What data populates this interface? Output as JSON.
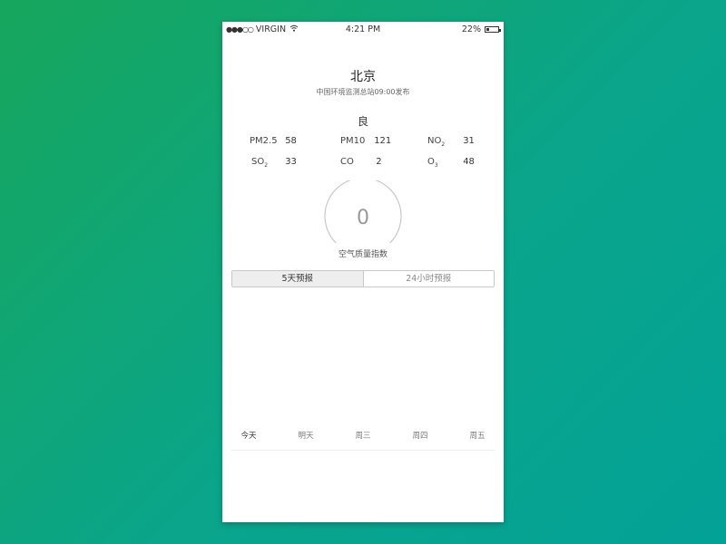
{
  "status_bar": {
    "carrier": "VIRGIN",
    "signal_dots": "●●●○○",
    "time": "4:21 PM",
    "battery_text": "22%",
    "battery_level": 0.22
  },
  "header": {
    "city": "北京",
    "source": "中国环境监测总站09:00发布",
    "quality": "良"
  },
  "pollutants": {
    "pm25": {
      "label": "PM2.5",
      "value": "58"
    },
    "pm10": {
      "label": "PM10",
      "value": "121"
    },
    "no2": {
      "label": "NO",
      "sub": "2",
      "value": "31"
    },
    "so2": {
      "label": "SO",
      "sub": "2",
      "value": "33"
    },
    "co": {
      "label": "CO",
      "value": "2"
    },
    "o3": {
      "label": "O",
      "sub": "3",
      "value": "48"
    }
  },
  "aqi": {
    "value": "0",
    "label": "空气质量指数"
  },
  "tabs": {
    "five_day": "5天预报",
    "hourly": "24小时预报"
  },
  "forecast_days": [
    "今天",
    "明天",
    "周三",
    "周四",
    "周五"
  ],
  "colors": {
    "background_start": "#17a65c",
    "background_end": "#03a297",
    "ring": "#c8c8c8"
  }
}
